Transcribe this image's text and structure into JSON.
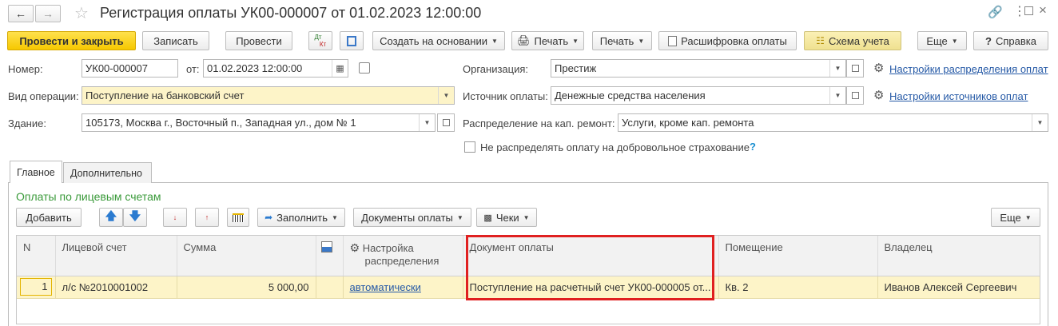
{
  "window": {
    "title": "Регистрация оплаты УК00-000007 от 01.02.2023 12:00:00",
    "back_icon": "arrow-left-icon",
    "forward_icon": "arrow-right-icon",
    "star_icon": "star-icon"
  },
  "toolbar": {
    "post_close": "Провести и закрыть",
    "save": "Записать",
    "post": "Провести",
    "dt_kt_top": "Дт",
    "dt_kt_bottom": "Кт",
    "create_based": "Создать на основании",
    "print_icon": "Печать",
    "print": "Печать",
    "decode": "Расшифровка оплаты",
    "scheme": "Схема учета",
    "more": "Еще",
    "help": "Справка",
    "help_glyph": "?"
  },
  "form": {
    "number_label": "Номер:",
    "number_value": "УК00-000007",
    "from_label": "от:",
    "date_value": "01.02.2023 12:00:00",
    "op_type_label": "Вид операции:",
    "op_type_value": "Поступление на банковский счет",
    "building_label": "Здание:",
    "building_value": "105173, Москва г., Восточный п., Западная ул., дом № 1",
    "org_label": "Организация:",
    "org_value": "Престиж",
    "source_label": "Источник оплаты:",
    "source_value": "Денежные средства населения",
    "repair_label": "Распределение на кап. ремонт:",
    "repair_value": "Услуги, кроме кап. ремонта",
    "dist_settings_link": "Настройки распределения оплат",
    "source_settings_link": "Настройки источников оплат",
    "no_insurance_label": "Не распределять оплату на добровольное страхование",
    "question": "?"
  },
  "tabs": [
    {
      "label": "Главное",
      "active": true
    },
    {
      "label": "Дополнительно",
      "active": false
    }
  ],
  "section": {
    "title": "Оплаты по лицевым счетам",
    "add": "Добавить",
    "fill": "Заполнить",
    "payment_docs": "Документы оплаты",
    "checks": "Чеки",
    "more": "Еще"
  },
  "table": {
    "headers": {
      "n": "N",
      "account": "Лицевой счет",
      "sum": "Сумма",
      "setting_line1": "Настройка",
      "setting_line2": "распределения",
      "document": "Документ оплаты",
      "room": "Помещение",
      "owner": "Владелец"
    },
    "rows": [
      {
        "n": "1",
        "account": "л/с №2010001002",
        "sum": "5 000,00",
        "setting": "автоматически",
        "document": "Поступление на расчетный счет УК00-000005 от...",
        "room": "Кв. 2",
        "owner": "Иванов Алексей Сергеевич"
      }
    ]
  },
  "colors": {
    "accent_yellow": "#f6c800",
    "section_green": "#3a9a3a",
    "link_blue": "#2559a6",
    "highlight_red": "#e02020",
    "row_yellow": "#fdf4c8"
  }
}
